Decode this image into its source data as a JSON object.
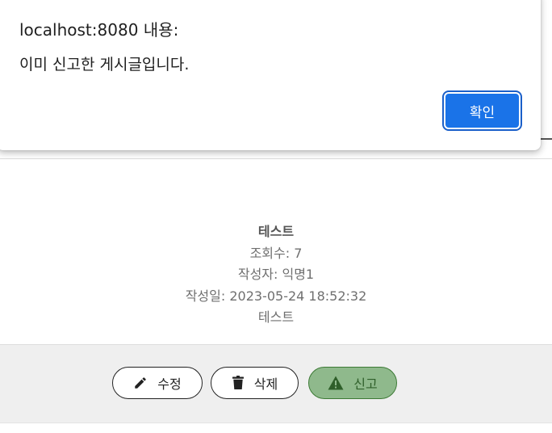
{
  "dialog": {
    "title": "localhost:8080 내용:",
    "message": "이미 신고한 게시글입니다.",
    "ok_label": "확인"
  },
  "post": {
    "title": "테스트",
    "views": "조회수: 7",
    "author": "작성자: 익명1",
    "date": "작성일: 2023-05-24 18:52:32",
    "content": "테스트"
  },
  "actions": {
    "edit_label": "수정",
    "edit_icon": "pencil-icon",
    "delete_label": "삭제",
    "delete_icon": "trash-icon",
    "report_label": "신고",
    "report_icon": "warning-icon"
  },
  "colors": {
    "dialog_button": "#1a73e8",
    "report_button_bg": "#8fb98c",
    "report_button_border": "#3c7a35",
    "action_bar_bg": "#efefef"
  }
}
